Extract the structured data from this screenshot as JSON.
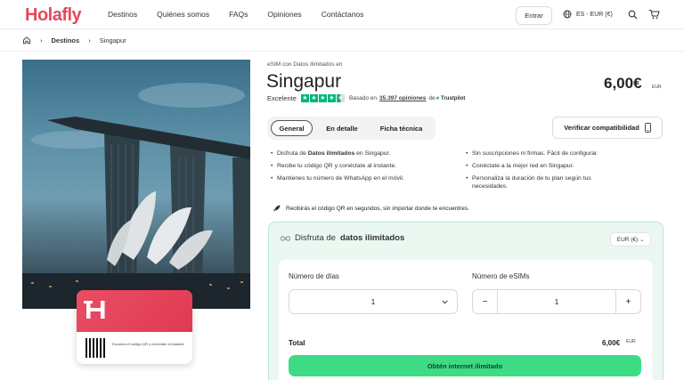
{
  "brand": {
    "logo": "Holafly",
    "accent": "#e6485d"
  },
  "nav": {
    "items": [
      "Destinos",
      "Quiénes somos",
      "FAQs",
      "Opiniones",
      "Contáctanos"
    ]
  },
  "header": {
    "login_label": "Entrar",
    "lang_label": "ES - EUR (€)",
    "icons": [
      "globe-icon",
      "search-icon",
      "cart-icon"
    ]
  },
  "breadcrumb": {
    "home_icon": "home-icon",
    "items": [
      "Destinos",
      "Singapur"
    ]
  },
  "card": {
    "caption": "Escanea el código QR y conéctate al instante"
  },
  "product": {
    "subtitle": "eSIM con Datos Ilimitados en",
    "title": "Singapur",
    "price": "6,00€",
    "price_currency": "EUR",
    "rating_label": "Excelente",
    "rating_stars": 4.5,
    "reviews_prefix": "Basado en",
    "reviews_link": "35.397 opiniones",
    "reviews_suffix": "de",
    "trustpilot": "Trustpilot"
  },
  "tabs": {
    "items": [
      "General",
      "En detalle",
      "Ficha técnica"
    ],
    "active": "General"
  },
  "verify_label": "Verificar compatibilidad",
  "features": {
    "left": [
      {
        "pre": "Disfruta de ",
        "bold": "Datos ilimitados",
        "post": " en Singapur."
      },
      {
        "pre": "Recibe tu código QR y conéctate al instante.",
        "bold": "",
        "post": ""
      },
      {
        "pre": "Mantienes tu número de WhatsApp en el móvil.",
        "bold": "",
        "post": ""
      }
    ],
    "right": [
      "Sin suscripciones ni firmas. Fácil de configurar.",
      "Conéctate a la mejor red en Singapur.",
      "Personaliza la duración de tu plan según tus necesidades."
    ]
  },
  "promo": "Recibirás el código QR en segundos, sin importar donde te encuentres.",
  "plan": {
    "title_pre": "Disfruta de",
    "title_bold": "datos ilimitados",
    "currency_select": "EUR (€)",
    "days_label": "Número de días",
    "days_value": "1",
    "esims_label": "Número de eSIMs",
    "esims_value": "1",
    "minus": "−",
    "plus": "+",
    "total_label": "Total",
    "total_value": "6,00€",
    "total_currency": "EUR",
    "cta": "Obtén internet ilimitado"
  }
}
